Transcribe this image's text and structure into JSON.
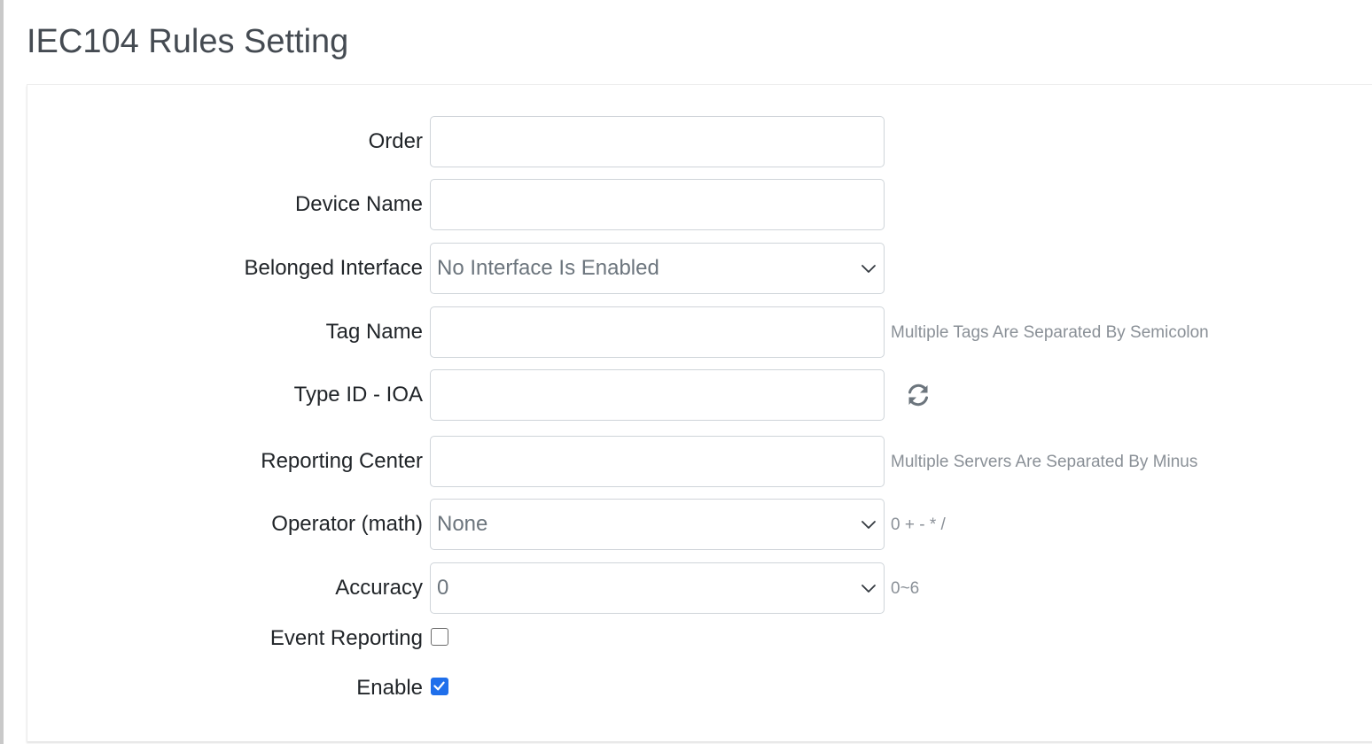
{
  "page": {
    "title": "IEC104 Rules Setting"
  },
  "form": {
    "order": {
      "label": "Order",
      "value": ""
    },
    "device_name": {
      "label": "Device Name",
      "value": ""
    },
    "belonged_interface": {
      "label": "Belonged Interface",
      "selected": "No Interface Is Enabled"
    },
    "tag_name": {
      "label": "Tag Name",
      "value": "",
      "help": "Multiple Tags Are Separated By Semicolon"
    },
    "type_id_ioa": {
      "label": "Type ID - IOA",
      "value": "",
      "action_icon": "refresh-icon"
    },
    "reporting_center": {
      "label": "Reporting Center",
      "value": "",
      "help": "Multiple Servers Are Separated By Minus"
    },
    "operator": {
      "label": "Operator (math)",
      "selected": "None",
      "help": "0 + - * /"
    },
    "accuracy": {
      "label": "Accuracy",
      "selected": "0",
      "help": "0~6"
    },
    "event_reporting": {
      "label": "Event Reporting",
      "checked": false
    },
    "enable": {
      "label": "Enable",
      "checked": true
    }
  },
  "colors": {
    "accent": "#1f6feb",
    "label": "#212529",
    "muted": "#8a9097",
    "title": "#454b52"
  }
}
